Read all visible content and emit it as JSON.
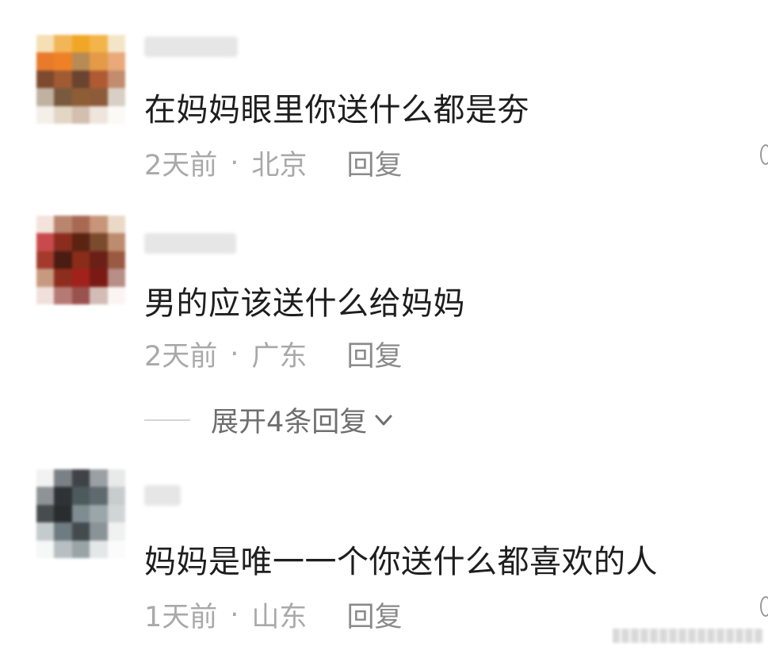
{
  "comments": [
    {
      "content": "在妈妈眼里你送什么都是夯",
      "time": "2天前",
      "location": "北京",
      "reply_label": "回复",
      "avatar_colors": [
        "#f6dfb4",
        "#f2b659",
        "#f1a725",
        "#f3b44a",
        "#f3e6c8",
        "#e87a2c",
        "#ee8128",
        "#b78b55",
        "#e49a46",
        "#e9a979",
        "#7d4a2f",
        "#a25a33",
        "#6a4430",
        "#b05a34",
        "#c28c6e",
        "#bfb2a0",
        "#7a5a3e",
        "#8e5d36",
        "#8d5b3a",
        "#d8d0c4",
        "#f4efe8",
        "#e3d6c5",
        "#d3beb0",
        "#efe5dc",
        "#fbfaf7"
      ]
    },
    {
      "content": "男的应该送什么给妈妈",
      "time": "2天前",
      "location": "广东",
      "reply_label": "回复",
      "avatar_colors": [
        "#f3e3dc",
        "#b9856f",
        "#a86952",
        "#c89578",
        "#ead9c6",
        "#c84a4c",
        "#8a2d1e",
        "#5a2312",
        "#7c4a2c",
        "#bd8b6d",
        "#a33a2b",
        "#4a1c12",
        "#8a2c18",
        "#6a2016",
        "#9a5a42",
        "#c79a80",
        "#8d2d1f",
        "#a1221c",
        "#7b1a14",
        "#b88e86",
        "#f0e0dc",
        "#b57a74",
        "#99524e",
        "#d4bcb6",
        "#faf5f3"
      ]
    },
    {
      "content": "妈妈是唯一一个你送什么都喜欢的人",
      "time": "1天前",
      "location": "山东",
      "reply_label": "回复",
      "avatar_colors": [
        "#f2f2f2",
        "#7a8085",
        "#3f4347",
        "#9aa0a3",
        "#e8eaea",
        "#8e9396",
        "#2f3336",
        "#4d5a5c",
        "#5f6a6e",
        "#c9cccd",
        "#474c4f",
        "#2a2d2f",
        "#7f8d92",
        "#9aa6a9",
        "#d2d5d6",
        "#c4cbcd",
        "#6e7b80",
        "#434b4e",
        "#8a9498",
        "#f0f1f1",
        "#f6f7f7",
        "#b7bfc2",
        "#9aa4a7",
        "#e4e7e8",
        "#fbfbfb"
      ]
    }
  ],
  "expand_label": "展开4条回复",
  "icons": {
    "expand": "chevron-down-icon"
  },
  "colors": {
    "text": "#1e1e1e",
    "meta": "#a9a9a9",
    "reply": "#8a8a8a",
    "expand": "#6f6f6f"
  }
}
